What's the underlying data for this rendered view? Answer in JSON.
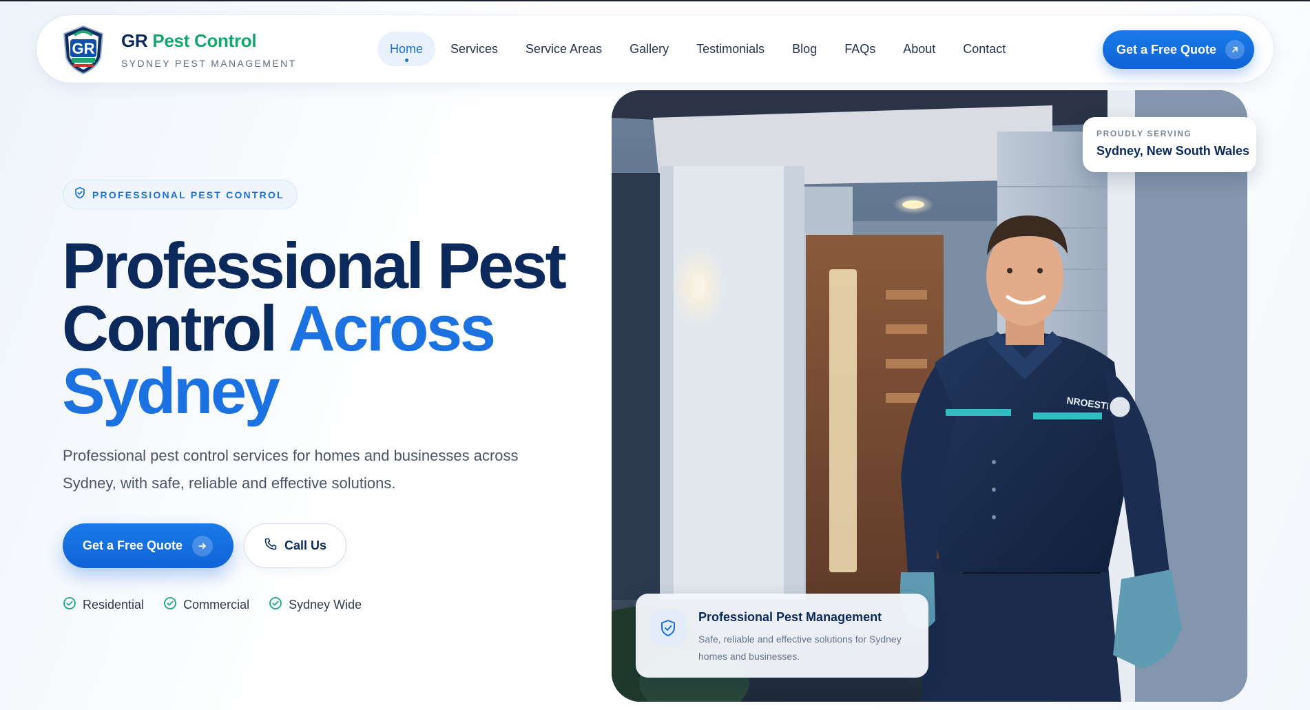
{
  "brand": {
    "name_part1": "GR",
    "name_part2": "Pest Control",
    "tagline": "SYDNEY PEST MANAGEMENT",
    "logo_icon": "gr-pest-control-shield-logo"
  },
  "nav": {
    "items": [
      {
        "label": "Home",
        "active": true
      },
      {
        "label": "Services",
        "active": false
      },
      {
        "label": "Service Areas",
        "active": false
      },
      {
        "label": "Gallery",
        "active": false
      },
      {
        "label": "Testimonials",
        "active": false
      },
      {
        "label": "Blog",
        "active": false
      },
      {
        "label": "FAQs",
        "active": false
      },
      {
        "label": "About",
        "active": false
      },
      {
        "label": "Contact",
        "active": false
      }
    ],
    "cta_label": "Get a Free Quote",
    "cta_icon": "arrow-up-right-icon"
  },
  "hero": {
    "badge": "PROFESSIONAL PEST CONTROL",
    "badge_icon": "shield-check-icon",
    "headline_line1": "Professional Pest",
    "headline_line2_dark": "Control",
    "headline_line2_highlight": "Across",
    "headline_line3_highlight": "Sydney",
    "lead": "Professional pest control services for homes and businesses across Sydney, with safe, reliable and effective solutions.",
    "primary_cta": "Get a Free Quote",
    "primary_cta_icon": "arrow-right-icon",
    "secondary_cta": "Call Us",
    "secondary_cta_icon": "phone-icon",
    "features": [
      "Residential",
      "Commercial",
      "Sydney Wide"
    ]
  },
  "image_card": {
    "serving_label": "PROUDLY SERVING",
    "serving_value": "Sydney, New South Wales",
    "info_title": "Professional Pest Management",
    "info_desc": "Safe, reliable and effective solutions for Sydney homes and businesses.",
    "info_icon": "shield-check-icon",
    "uniform_text": "NROESTR"
  },
  "colors": {
    "navy": "#0b2a5b",
    "accent_blue": "#1b72e0",
    "brand_green": "#15a66f",
    "check_teal": "#1aa58a"
  }
}
